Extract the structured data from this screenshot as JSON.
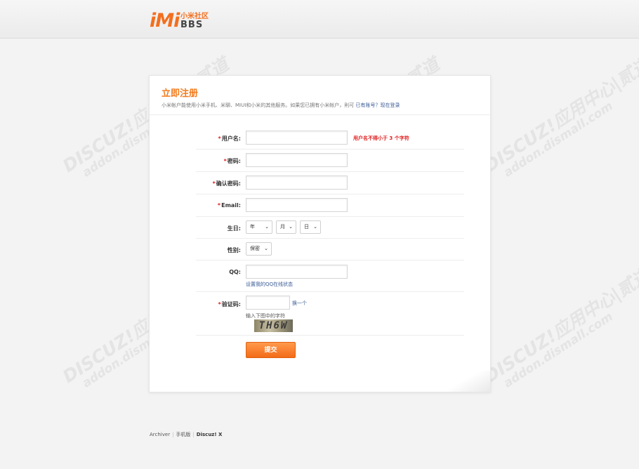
{
  "header": {
    "logo_imi": "iMi",
    "logo_cn": "小米社区",
    "logo_bbs": "BBS"
  },
  "form": {
    "title": "立即注册",
    "subtitle": "小米帐户能使用小米手机、米聊、MIUI和小米的其他服务。如果您已拥有小米帐户，則可",
    "login_link": "已有账号？现在登录",
    "required_mark": "*",
    "fields": {
      "username": {
        "label": "用户名:",
        "value": "",
        "error": "用户名不得小于 3 个字符"
      },
      "password": {
        "label": "密码:",
        "value": ""
      },
      "confirm_password": {
        "label": "确认密码:",
        "value": ""
      },
      "email": {
        "label": "Email:",
        "value": ""
      },
      "birthday": {
        "label": "生日:",
        "year": "年",
        "month": "月",
        "day": "日"
      },
      "gender": {
        "label": "性别:",
        "value": "保密"
      },
      "qq": {
        "label": "QQ:",
        "value": "",
        "hint_link": "设置我的QQ在线状态"
      },
      "captcha": {
        "label": "验证码:",
        "value": "",
        "refresh": "换一个",
        "hint": "输入下图中的字符",
        "image_text": "TH6W"
      }
    },
    "submit_label": "提交"
  },
  "footer": {
    "archiver": "Archiver",
    "mobile": "手机版",
    "brand": "Discuz! X"
  },
  "watermark": {
    "line1": "DISCUZ!应用中心|贰道",
    "line2": "addon.dismall.com"
  },
  "colors": {
    "accent": "#f37b1d",
    "error": "#e02020",
    "link": "#3a5a95",
    "background": "#f3f3f3"
  }
}
